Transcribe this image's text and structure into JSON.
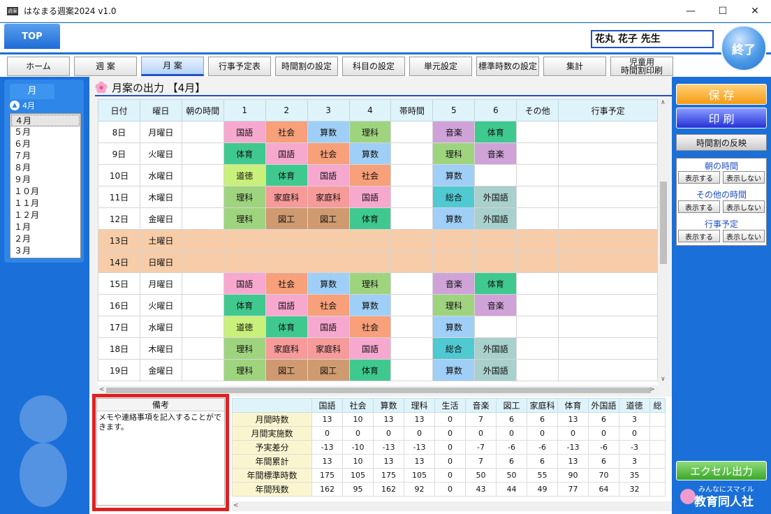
{
  "window": {
    "title": "はなまる週案2024 v1.0",
    "icon_text": "週案",
    "min": "—",
    "max": "☐",
    "close": "✕"
  },
  "header": {
    "top_tab": "TOP",
    "teacher": "花丸 花子 先生",
    "exit": "終了"
  },
  "nav": [
    "ホーム",
    "週 案",
    "月 案",
    "行事予定表",
    "時間割の設定",
    "科目の設定",
    "単元設定",
    "標準時数の設定",
    "集計",
    "児童用\n時間割印刷"
  ],
  "month_panel": {
    "tab": "月",
    "current": "4月",
    "months": [
      "４月",
      "５月",
      "６月",
      "７月",
      "８月",
      "９月",
      "１０月",
      "１１月",
      "１２月",
      "１月",
      "２月",
      "３月"
    ]
  },
  "section_title": "月案の出力 【4月】",
  "grid": {
    "headers": [
      "日付",
      "曜日",
      "朝の時間",
      "1",
      "2",
      "3",
      "4",
      "帯時間",
      "5",
      "6",
      "その他",
      "行事予定"
    ],
    "rows": [
      {
        "date": "8日",
        "day": "月曜日",
        "cells": [
          "",
          "国語",
          "社会",
          "算数",
          "理科",
          "",
          "音楽",
          "体育",
          "",
          ""
        ]
      },
      {
        "date": "9日",
        "day": "火曜日",
        "cells": [
          "",
          "体育",
          "国語",
          "社会",
          "算数",
          "",
          "理科",
          "音楽",
          "",
          ""
        ]
      },
      {
        "date": "10日",
        "day": "水曜日",
        "cells": [
          "",
          "道徳",
          "体育",
          "国語",
          "社会",
          "",
          "算数",
          "",
          "",
          ""
        ]
      },
      {
        "date": "11日",
        "day": "木曜日",
        "cells": [
          "",
          "理科",
          "家庭科",
          "家庭科",
          "国語",
          "",
          "総合",
          "外国語",
          "",
          ""
        ]
      },
      {
        "date": "12日",
        "day": "金曜日",
        "cells": [
          "",
          "理科",
          "図工",
          "図工",
          "体育",
          "",
          "算数",
          "外国語",
          "",
          ""
        ]
      },
      {
        "date": "13日",
        "day": "土曜日",
        "weekend": true,
        "cells": [
          "",
          "",
          "",
          "",
          "",
          "",
          "",
          "",
          "",
          ""
        ]
      },
      {
        "date": "14日",
        "day": "日曜日",
        "weekend": true,
        "cells": [
          "",
          "",
          "",
          "",
          "",
          "",
          "",
          "",
          "",
          ""
        ]
      },
      {
        "date": "15日",
        "day": "月曜日",
        "cells": [
          "",
          "国語",
          "社会",
          "算数",
          "理科",
          "",
          "音楽",
          "体育",
          "",
          ""
        ]
      },
      {
        "date": "16日",
        "day": "火曜日",
        "cells": [
          "",
          "体育",
          "国語",
          "社会",
          "算数",
          "",
          "理科",
          "音楽",
          "",
          ""
        ]
      },
      {
        "date": "17日",
        "day": "水曜日",
        "cells": [
          "",
          "道徳",
          "体育",
          "国語",
          "社会",
          "",
          "算数",
          "",
          "",
          ""
        ]
      },
      {
        "date": "18日",
        "day": "木曜日",
        "cells": [
          "",
          "理科",
          "家庭科",
          "家庭科",
          "国語",
          "",
          "総合",
          "外国語",
          "",
          ""
        ]
      },
      {
        "date": "19日",
        "day": "金曜日",
        "cells": [
          "",
          "理科",
          "図工",
          "図工",
          "体育",
          "",
          "算数",
          "外国語",
          "",
          ""
        ]
      }
    ]
  },
  "subject_colors": {
    "国語": "#f7a8cf",
    "社会": "#f7a07a",
    "算数": "#9fcff7",
    "理科": "#9fd47f",
    "音楽": "#cfa3d8",
    "体育": "#3fc98f",
    "道徳": "#c8f07a",
    "家庭科": "#f79a9a",
    "図工": "#cf9a70",
    "総合": "#4fc9d2",
    "外国語": "#a8d0cc"
  },
  "memo": {
    "header": "備考",
    "text": "メモや連絡事項を記入することができます。"
  },
  "summary": {
    "headers": [
      "国語",
      "社会",
      "算数",
      "理科",
      "生活",
      "音楽",
      "図工",
      "家庭科",
      "体育",
      "外国語",
      "道徳",
      "総"
    ],
    "rows": [
      {
        "label": "月間時数",
        "values": [
          "13",
          "10",
          "13",
          "13",
          "0",
          "7",
          "6",
          "6",
          "13",
          "6",
          "3"
        ]
      },
      {
        "label": "月間実施数",
        "values": [
          "0",
          "0",
          "0",
          "0",
          "0",
          "0",
          "0",
          "0",
          "0",
          "0",
          "0"
        ]
      },
      {
        "label": "予実差分",
        "values": [
          "-13",
          "-10",
          "-13",
          "-13",
          "0",
          "-7",
          "-6",
          "-6",
          "-13",
          "-6",
          "-3"
        ]
      },
      {
        "label": "年間累計",
        "values": [
          "13",
          "10",
          "13",
          "13",
          "0",
          "7",
          "6",
          "6",
          "13",
          "6",
          "3"
        ]
      },
      {
        "label": "年間標準時数",
        "values": [
          "175",
          "105",
          "175",
          "105",
          "0",
          "50",
          "50",
          "55",
          "90",
          "70",
          "35"
        ]
      },
      {
        "label": "年間残数",
        "values": [
          "162",
          "95",
          "162",
          "92",
          "0",
          "43",
          "44",
          "49",
          "77",
          "64",
          "32"
        ]
      }
    ]
  },
  "right_panel": {
    "save": "保 存",
    "print": "印 刷",
    "apply_timetable": "時間割の反映",
    "morning": "朝の時間",
    "other": "その他の時間",
    "events": "行事予定",
    "show": "表示する",
    "hide": "表示しない",
    "excel": "エクセル出力"
  },
  "logo": {
    "sub": "みんなにスマイル",
    "main": "教育同人社"
  }
}
